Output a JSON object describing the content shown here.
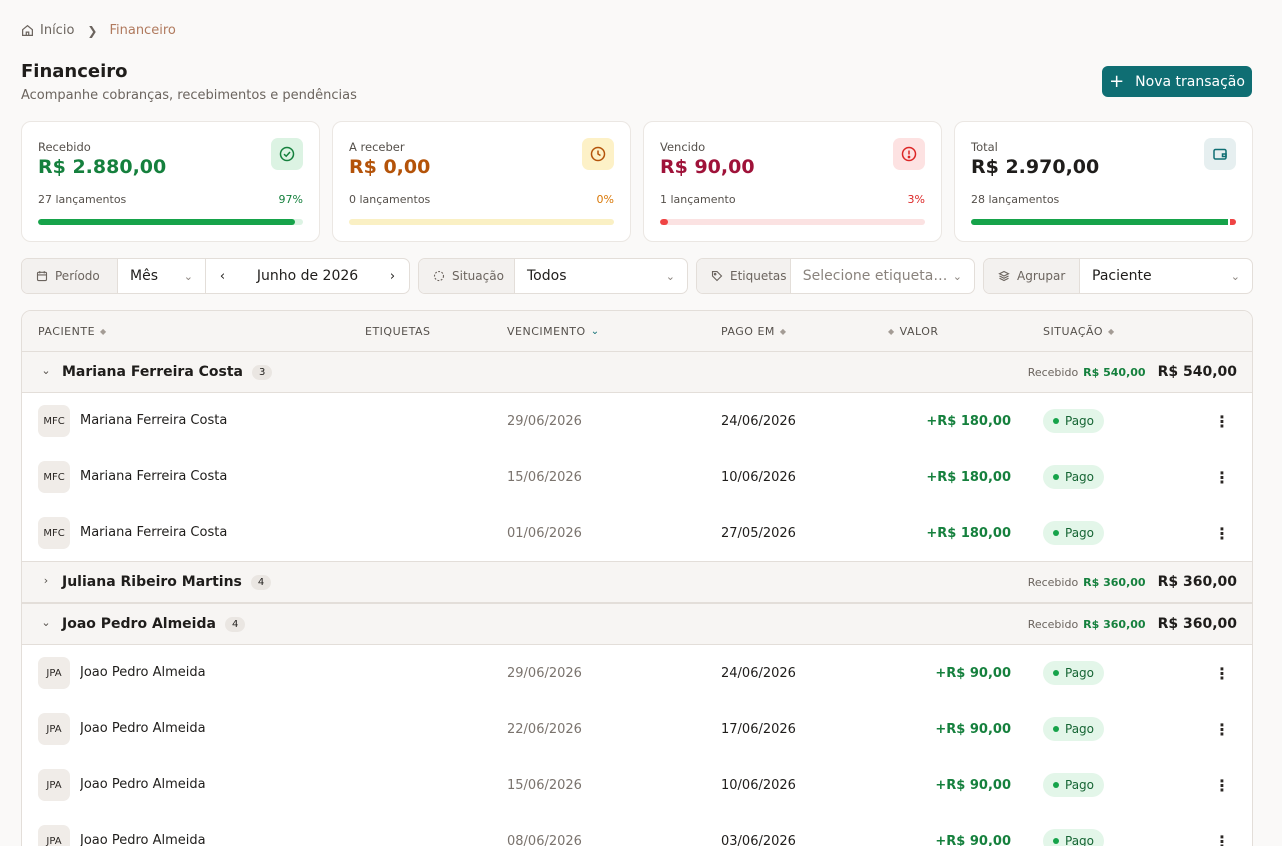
{
  "breadcrumb": {
    "home": "Início",
    "current": "Financeiro"
  },
  "header": {
    "title": "Financeiro",
    "subtitle": "Acompanhe cobranças, recebimentos e pendências",
    "new_button": "Nova transação"
  },
  "cards": [
    {
      "label": "Recebido",
      "value": "R$ 2.880,00",
      "count": "27 lançamentos",
      "pct": "97%",
      "fill": 0.97,
      "color": "#15803d",
      "track": "#dcf3e3",
      "icon": "check-circle-icon"
    },
    {
      "label": "A receber",
      "value": "R$ 0,00",
      "count": "0 lançamentos",
      "pct": "0%",
      "fill": 0,
      "color": "#b45309",
      "track": "#faf0c4",
      "icon": "clock-icon"
    },
    {
      "label": "Vencido",
      "value": "R$ 90,00",
      "count": "1 lançamento",
      "pct": "3%",
      "fill": 0.03,
      "color": "#be123c",
      "track": "#fbe2e2",
      "icon": "alert-circle-icon"
    },
    {
      "label": "Total",
      "value": "R$ 2.970,00",
      "count": "28 lançamentos",
      "fill_received": 0.97,
      "fill_overdue": 0.03,
      "icon": "wallet-icon"
    }
  ],
  "filters": {
    "period_label": "Período",
    "period_mode": "Mês",
    "period_value": "Junho de 2026",
    "status_label": "Situação",
    "status_value": "Todos",
    "tags_label": "Etiquetas",
    "tags_placeholder": "Selecione etiquetas...",
    "group_label": "Agrupar",
    "group_value": "Paciente"
  },
  "table": {
    "columns": {
      "patient": "PACIENTE",
      "tags": "ETIQUETAS",
      "due": "VENCIMENTO",
      "paid": "PAGO EM",
      "value": "VALOR",
      "status": "SITUAÇÃO"
    },
    "received_label": "Recebido",
    "groups": [
      {
        "name": "Mariana Ferreira Costa",
        "count": "3",
        "expanded": true,
        "received": "R$ 540,00",
        "total": "R$ 540,00",
        "rows": [
          {
            "initials": "MFC",
            "name": "Mariana Ferreira Costa",
            "due": "29/06/2026",
            "paid": "24/06/2026",
            "amount": "+R$ 180,00",
            "status": "Pago"
          },
          {
            "initials": "MFC",
            "name": "Mariana Ferreira Costa",
            "due": "15/06/2026",
            "paid": "10/06/2026",
            "amount": "+R$ 180,00",
            "status": "Pago"
          },
          {
            "initials": "MFC",
            "name": "Mariana Ferreira Costa",
            "due": "01/06/2026",
            "paid": "27/05/2026",
            "amount": "+R$ 180,00",
            "status": "Pago"
          }
        ]
      },
      {
        "name": "Juliana Ribeiro Martins",
        "count": "4",
        "expanded": false,
        "received": "R$ 360,00",
        "total": "R$ 360,00",
        "rows": []
      },
      {
        "name": "Joao Pedro Almeida",
        "count": "4",
        "expanded": true,
        "received": "R$ 360,00",
        "total": "R$ 360,00",
        "rows": [
          {
            "initials": "JPA",
            "name": "Joao Pedro Almeida",
            "due": "29/06/2026",
            "paid": "24/06/2026",
            "amount": "+R$ 90,00",
            "status": "Pago"
          },
          {
            "initials": "JPA",
            "name": "Joao Pedro Almeida",
            "due": "22/06/2026",
            "paid": "17/06/2026",
            "amount": "+R$ 90,00",
            "status": "Pago"
          },
          {
            "initials": "JPA",
            "name": "Joao Pedro Almeida",
            "due": "15/06/2026",
            "paid": "10/06/2026",
            "amount": "+R$ 90,00",
            "status": "Pago"
          },
          {
            "initials": "JPA",
            "name": "Joao Pedro Almeida",
            "due": "08/06/2026",
            "paid": "03/06/2026",
            "amount": "+R$ 90,00",
            "status": "Pago"
          }
        ]
      }
    ]
  }
}
